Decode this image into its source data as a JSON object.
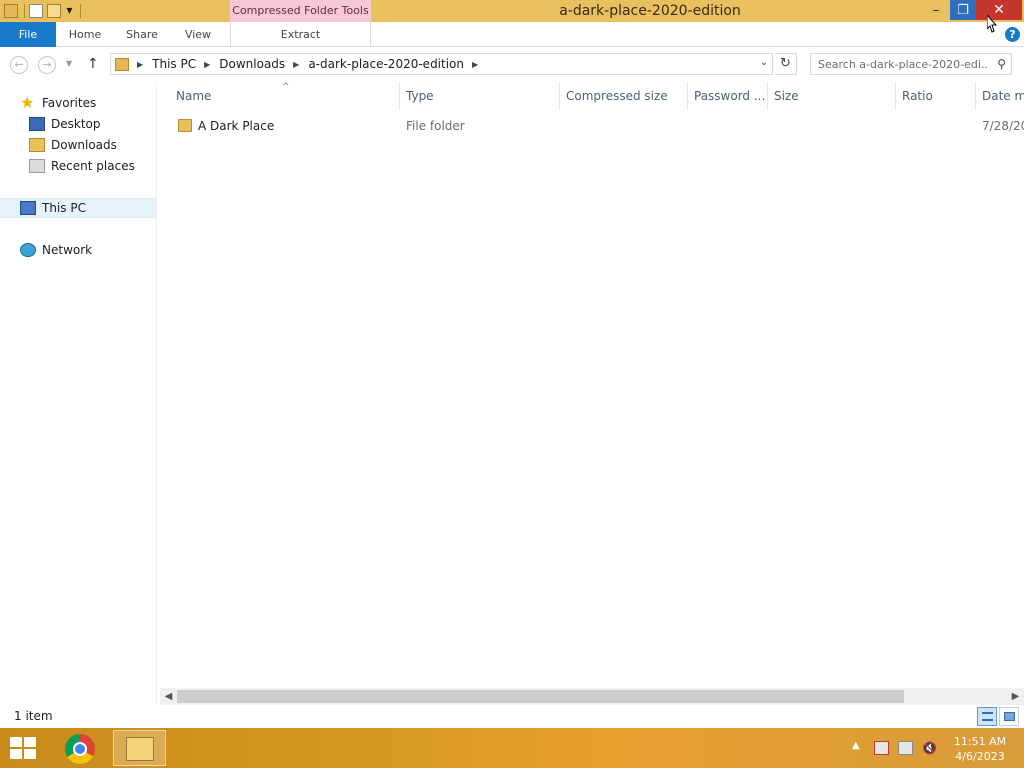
{
  "window": {
    "title": "a-dark-place-2020-edition",
    "context_tab_group": "Compressed Folder Tools",
    "minimize_glyph": "–",
    "maximize_glyph": "❐",
    "close_glyph": "✕"
  },
  "ribbon": {
    "tabs": [
      {
        "label": "File"
      },
      {
        "label": "Home"
      },
      {
        "label": "Share"
      },
      {
        "label": "View"
      },
      {
        "label": "Extract"
      }
    ],
    "help_glyph": "?"
  },
  "address_bar": {
    "breadcrumbs": [
      "This PC",
      "Downloads",
      "a-dark-place-2020-edition"
    ],
    "search_placeholder": "Search a-dark-place-2020-edi..."
  },
  "nav_pane": {
    "favorites_label": "Favorites",
    "favorites": [
      "Desktop",
      "Downloads",
      "Recent places"
    ],
    "this_pc_label": "This PC",
    "network_label": "Network"
  },
  "file_list": {
    "columns": [
      "Name",
      "Type",
      "Compressed size",
      "Password ...",
      "Size",
      "Ratio",
      "Date mo"
    ],
    "rows": [
      {
        "name": "A Dark Place",
        "type": "File folder",
        "date": "7/28/20"
      }
    ]
  },
  "status": {
    "item_count": "1 item"
  },
  "taskbar": {
    "time": "11:51 AM",
    "date": "4/6/2023"
  },
  "colors": {
    "title_bar": "#e8c060",
    "context_tab": "#f7c8d6",
    "file_tab": "#1979ca",
    "close_button": "#c4362c",
    "selection": "#e5f3fb"
  }
}
